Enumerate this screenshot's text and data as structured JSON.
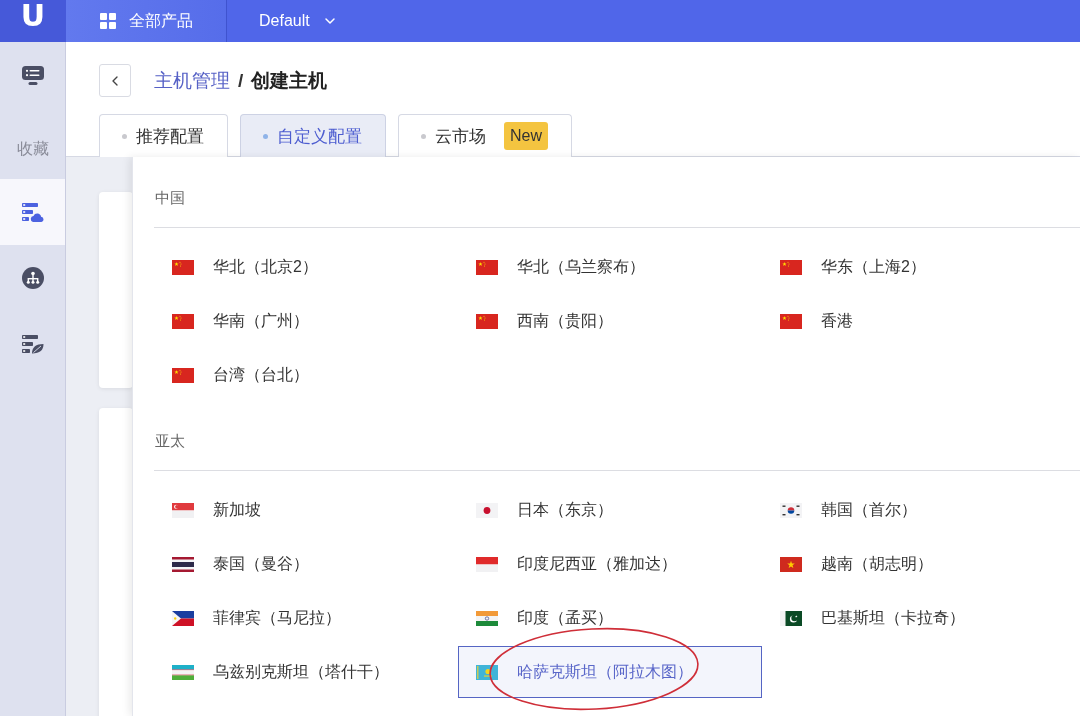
{
  "top_bar": {
    "logo": "U",
    "products_menu": {
      "label": "全部产品"
    },
    "project_selector": {
      "value": "Default"
    }
  },
  "sidebar": {
    "items": [
      {
        "kind": "monitor",
        "selected": false
      }
    ],
    "favorites_label": "收藏",
    "favorites": [
      {
        "kind": "server-cloud",
        "selected": true
      },
      {
        "kind": "network",
        "selected": false
      },
      {
        "kind": "server-leaf",
        "selected": false
      }
    ]
  },
  "breadcrumb": {
    "items": [
      {
        "label": "主机管理",
        "kind": "link"
      },
      {
        "label": "创建主机",
        "kind": "current"
      }
    ],
    "separator": "/"
  },
  "tabs": [
    {
      "label": "推荐配置",
      "selected": false
    },
    {
      "label": "自定义配置",
      "selected": true
    },
    {
      "label": "云市场",
      "selected": false,
      "badge": "New"
    }
  ],
  "region_menu": {
    "sections": [
      {
        "title": "中国",
        "regions": [
          {
            "name": "华北（北京2）",
            "kind": "china",
            "selected": false
          },
          {
            "name": "华北（乌兰察布）",
            "kind": "china",
            "selected": false
          },
          {
            "name": "华东（上海2）",
            "kind": "china",
            "selected": false
          },
          {
            "name": "华南（广州）",
            "kind": "china",
            "selected": false
          },
          {
            "name": "西南（贵阳）",
            "kind": "china",
            "selected": false
          },
          {
            "name": "香港",
            "kind": "china",
            "selected": false
          },
          {
            "name": "台湾（台北）",
            "kind": "china",
            "selected": false
          }
        ]
      },
      {
        "title": "亚太",
        "regions": [
          {
            "name": "新加坡",
            "kind": "singapore",
            "selected": false
          },
          {
            "name": "日本（东京）",
            "kind": "japan",
            "selected": false
          },
          {
            "name": "韩国（首尔）",
            "kind": "korea",
            "selected": false
          },
          {
            "name": "泰国（曼谷）",
            "kind": "thailand",
            "selected": false
          },
          {
            "name": "印度尼西亚（雅加达）",
            "kind": "indonesia",
            "selected": false
          },
          {
            "name": "越南（胡志明）",
            "kind": "vietnam",
            "selected": false
          },
          {
            "name": "菲律宾（马尼拉）",
            "kind": "philippines",
            "selected": false
          },
          {
            "name": "印度（孟买）",
            "kind": "india",
            "selected": false
          },
          {
            "name": "巴基斯坦（卡拉奇）",
            "kind": "pakistan",
            "selected": false
          },
          {
            "name": "乌兹别克斯坦（塔什干）",
            "kind": "uzbekistan",
            "selected": false
          },
          {
            "name": "哈萨克斯坦（阿拉木图）",
            "kind": "kazakhstan",
            "selected": true
          }
        ]
      }
    ]
  }
}
